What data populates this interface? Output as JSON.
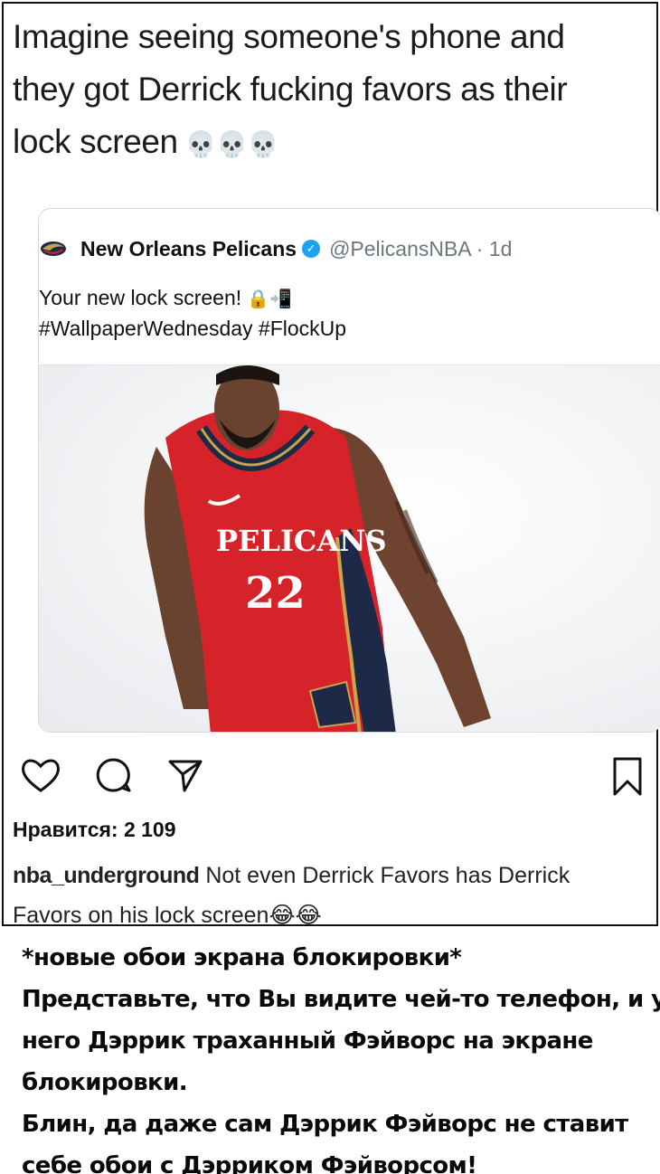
{
  "tweet": {
    "line1": "Imagine seeing someone's phone and",
    "line2": "they got Derrick fucking favors as their",
    "line3": "lock screen",
    "emoji": "💀💀💀"
  },
  "quote": {
    "team_name": "New Orleans Pelicans",
    "handle_time": "@PelicansNBA · 1d",
    "line1": "Your new lock screen!",
    "line1_emoji": "🔒📲",
    "line2": "#WallpaperWednesday #FlockUp",
    "jersey_text": "PELICANS",
    "jersey_number": "22"
  },
  "instagram": {
    "likes": "Нравится: 2 109",
    "caption_user": "nba_underground",
    "caption_text": " Not even Derrick Favors has Derrick",
    "caption_line2": "Favors on his lock screen",
    "caption_emoji": "😂😂"
  },
  "russian": {
    "line1": "*новые обои экрана блокировки*",
    "line2": "Представьте, что Вы видите чей-то телефон, и у",
    "line3": "него Дэррик траханный Фэйворс на экране",
    "line4": "блокировки.",
    "line5": "Блин, да даже сам Дэррик Фэйворс не ставит",
    "line6": "себе обои с Дэрриком Фэйворсом!"
  },
  "colors": {
    "jersey_red": "#d6232a",
    "jersey_navy": "#1c2a47",
    "jersey_gold": "#c9a44a",
    "verified_blue": "#1da1f2"
  }
}
